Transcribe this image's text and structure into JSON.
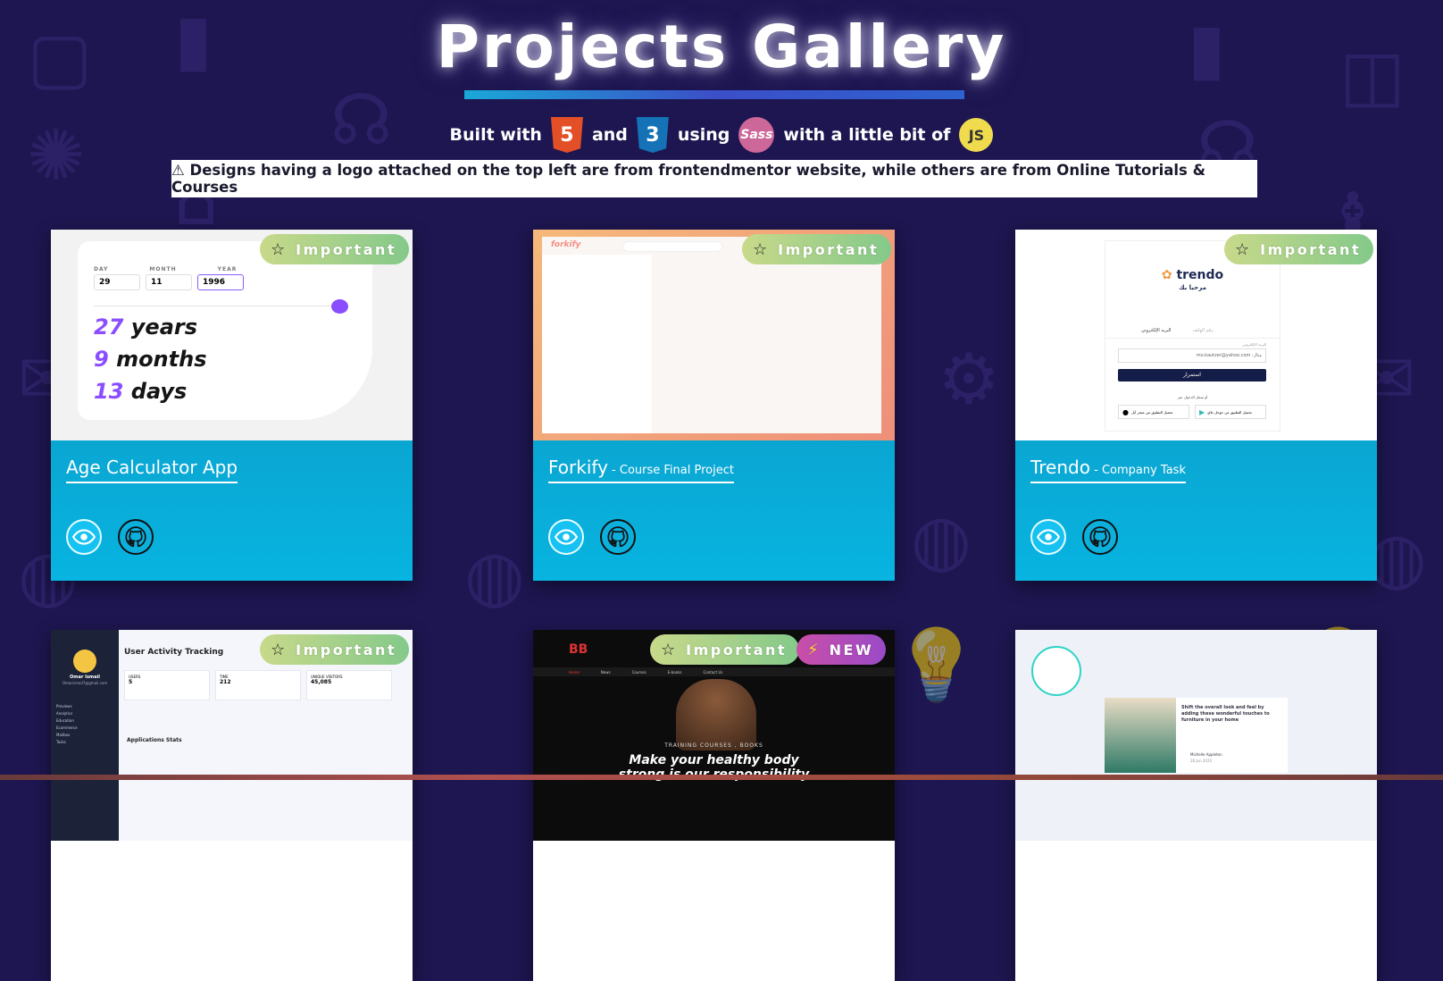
{
  "header": {
    "title": "Projects Gallery",
    "built_with": [
      "Built with",
      "and",
      "using",
      "with a little bit of"
    ],
    "tech": {
      "html": "5",
      "css": "3",
      "sass": "Sass",
      "js": "JS"
    }
  },
  "notice": "⚠ Designs having a logo attached on the top left are from frontendmentor website, while others are from Online Tutorials & Courses",
  "badges": {
    "important": "Important",
    "new": "NEW"
  },
  "cards": [
    {
      "title": "Age Calculator App",
      "subtitle": "",
      "thumb": {
        "labels": [
          "DAY",
          "MONTH",
          "YEAR"
        ],
        "inputs": [
          "29",
          "11",
          "1996"
        ],
        "result": [
          [
            "27",
            "years"
          ],
          [
            "9",
            "months"
          ],
          [
            "13",
            "days"
          ]
        ]
      }
    },
    {
      "title": "Forkify",
      "subtitle": " - Course Final Project",
      "thumb": {
        "logo": "forkify"
      }
    },
    {
      "title": "Trendo",
      "subtitle": " - Company Task",
      "thumb": {
        "logo": "trendo",
        "tagline": "مرحبا بك",
        "tabs": [
          "البريد الإلكتروني",
          "رقم الهاتف"
        ],
        "field_label": "البريد الإلكتروني",
        "field_value": "mo.kautzer@yahoo.com :مثال",
        "button": "استمرار",
        "or_text": "أو سجل الدخول عبر",
        "store1": "تحميل التطبيق من متجر أبل",
        "store2": "تحميل التطبيق من جوجل بلاي"
      }
    },
    {
      "title": "",
      "subtitle": "",
      "thumb": {
        "user": "Omar Ismail",
        "email": "Omarismail7@gmail.com",
        "page_title": "User Activity Tracking",
        "stats": [
          [
            "USERS",
            "5"
          ],
          [
            "TIME",
            "212"
          ],
          [
            "UNIQUE VISITORS",
            "45,085"
          ]
        ],
        "section": "Applications Stats",
        "menu": [
          "Previews",
          "Analytics",
          "Education",
          "Ecommerce",
          "Mailbox",
          "Tasks"
        ]
      }
    },
    {
      "title": "",
      "subtitle": "",
      "thumb": {
        "brand": "BB",
        "nav": [
          "Home",
          "News",
          "Courses",
          "E-books",
          "Contact Us"
        ],
        "cart": "Cart",
        "kicker": "TRAINING COURSES , BOOKS",
        "headline": "Make your healthy body",
        "headline2": "strong is our responsibility"
      }
    },
    {
      "title": "",
      "subtitle": "",
      "thumb": {
        "text": "Shift the overall look and feel by adding these wonderful touches to furniture in your home",
        "author": "Michelle Appleton",
        "date": "28 Jun 2020"
      }
    }
  ],
  "colors": {
    "bg": "#1d1650",
    "card_info": "#0aa6d2",
    "important_pill": "#a8d08a",
    "new_pill": "#b04cb8"
  }
}
